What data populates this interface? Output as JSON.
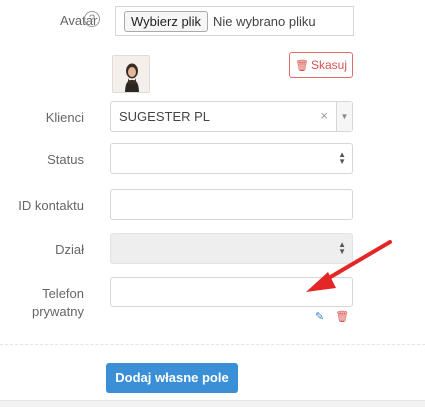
{
  "avatar": {
    "label": "Avatar",
    "help_glyph": "?",
    "file_button_label": "Wybierz plik",
    "file_status": "Nie wybrano pliku",
    "delete_label": "Skasuj"
  },
  "fields": {
    "klienci": {
      "label": "Klienci",
      "value": "SUGESTER PL",
      "clear_glyph": "×"
    },
    "status": {
      "label": "Status",
      "value": ""
    },
    "id_kontaktu": {
      "label": "ID kontaktu",
      "value": ""
    },
    "dzial": {
      "label": "Dział",
      "value": ""
    },
    "telefon": {
      "label_line1": "Telefon",
      "label_line2": "prywatny",
      "value": ""
    }
  },
  "add_custom_field_label": "Dodaj własne pole",
  "colors": {
    "primary": "#3a8fd6",
    "danger": "#d9534f",
    "annotation_arrow": "#e32626"
  }
}
